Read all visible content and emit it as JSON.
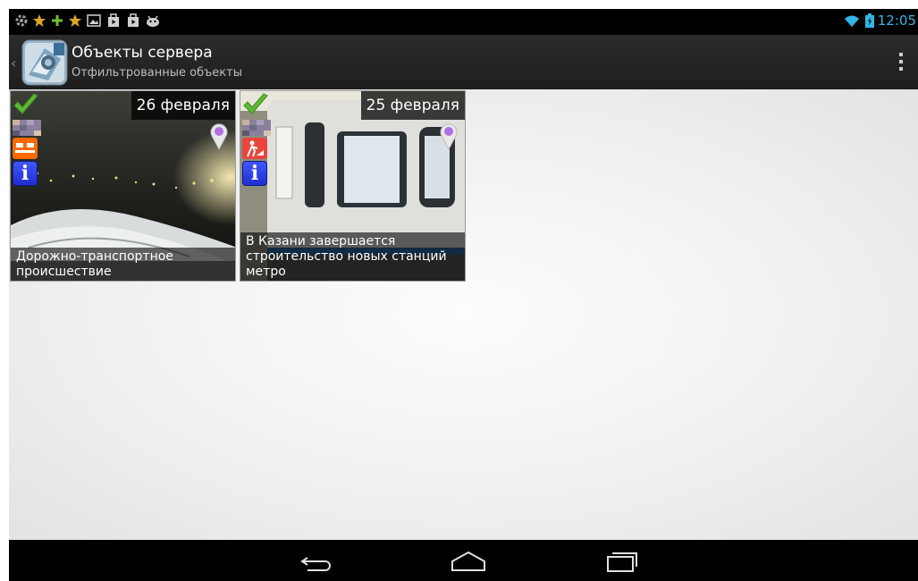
{
  "status_bar": {
    "time": "12:05",
    "left_icons": [
      "settings-icon",
      "star-icon",
      "plus-icon",
      "star-icon",
      "image-icon",
      "shop-icon",
      "shop-icon",
      "android-icon"
    ],
    "right_icons": [
      "wifi-icon",
      "battery-charging-icon"
    ]
  },
  "action_bar": {
    "title": "Объекты сервера",
    "subtitle": "Отфильтрованные объекты",
    "app_icon": "app-logo-icon",
    "overflow_icon": "overflow-menu-icon"
  },
  "objects": [
    {
      "date": "26 февраля",
      "caption": "Дорожно-транспортное происшествие",
      "category_icon": "accident-icon",
      "category_color": "#ff6a00"
    },
    {
      "date": "25 февраля",
      "caption": "В Казани завершается строительство новых станций метро",
      "category_icon": "construction-icon",
      "category_color": "#e8463c"
    }
  ],
  "navigation": [
    "back-icon",
    "home-icon",
    "recent-apps-icon"
  ],
  "colors": {
    "accent": "#33b5e5",
    "info": "#2b3dff",
    "check": "#5fb934",
    "pin": "#b070e0"
  }
}
